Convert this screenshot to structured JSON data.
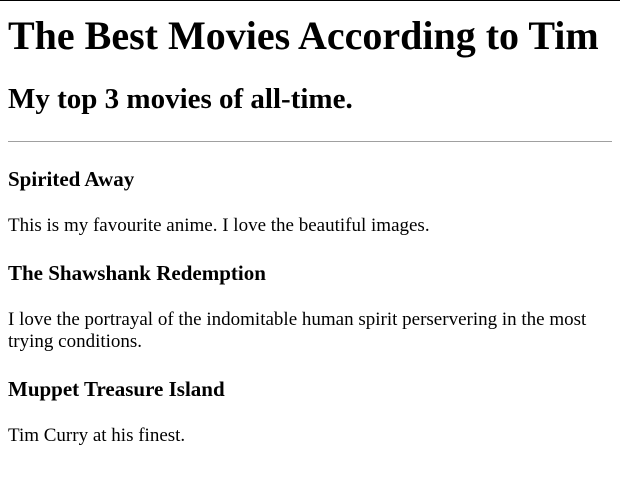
{
  "header": {
    "title": "The Best Movies According to Tim",
    "subtitle": "My top 3 movies of all-time."
  },
  "movies": [
    {
      "title": "Spirited Away",
      "description": "This is my favourite anime. I love the beautiful images."
    },
    {
      "title": "The Shawshank Redemption",
      "description": "I love the portrayal of the indomitable human spirit perservering in the most trying conditions."
    },
    {
      "title": "Muppet Treasure Island",
      "description": "Tim Curry at his finest."
    }
  ]
}
